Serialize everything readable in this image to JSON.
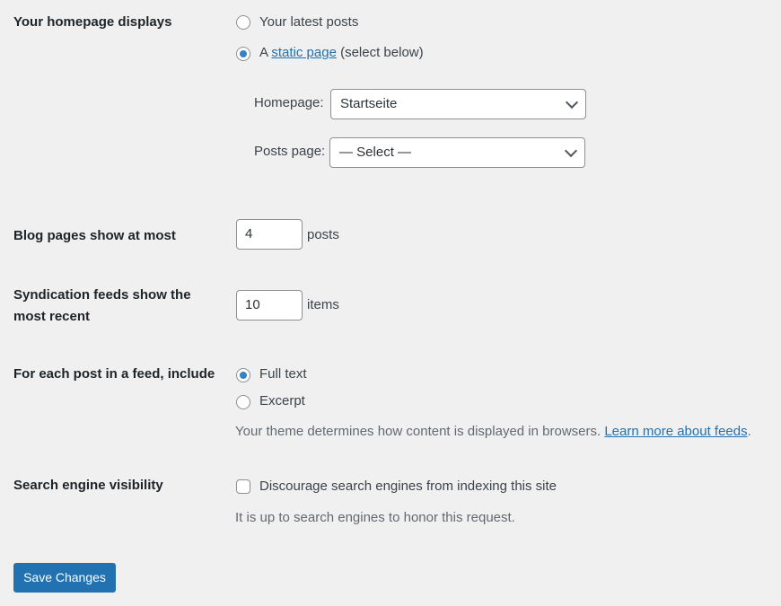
{
  "homepage_displays": {
    "label": "Your homepage displays",
    "options": [
      {
        "label": "Your latest posts",
        "checked": false
      },
      {
        "prefix": "A ",
        "link": "static page",
        "suffix": " (select below)",
        "checked": true
      }
    ],
    "homepage_label": "Homepage:",
    "homepage_value": "Startseite",
    "posts_page_label": "Posts page:",
    "posts_page_value": "— Select —"
  },
  "blog_pages": {
    "label": "Blog pages show at most",
    "value": "4",
    "unit": "posts"
  },
  "syndication": {
    "label": "Syndication feeds show the most recent",
    "value": "10",
    "unit": "items"
  },
  "feed_include": {
    "label": "For each post in a feed, include",
    "options": [
      {
        "label": "Full text",
        "checked": true
      },
      {
        "label": "Excerpt",
        "checked": false
      }
    ],
    "description": "Your theme determines how content is displayed in browsers. ",
    "link": "Learn more about feeds",
    "link_suffix": "."
  },
  "search_visibility": {
    "label": "Search engine visibility",
    "checkbox_label": "Discourage search engines from indexing this site",
    "checked": false,
    "description": "It is up to search engines to honor this request."
  },
  "save_button": "Save Changes",
  "colors": {
    "accent": "#2271b1",
    "radio_checked": "#3582c4",
    "background": "#f0f0f1"
  }
}
